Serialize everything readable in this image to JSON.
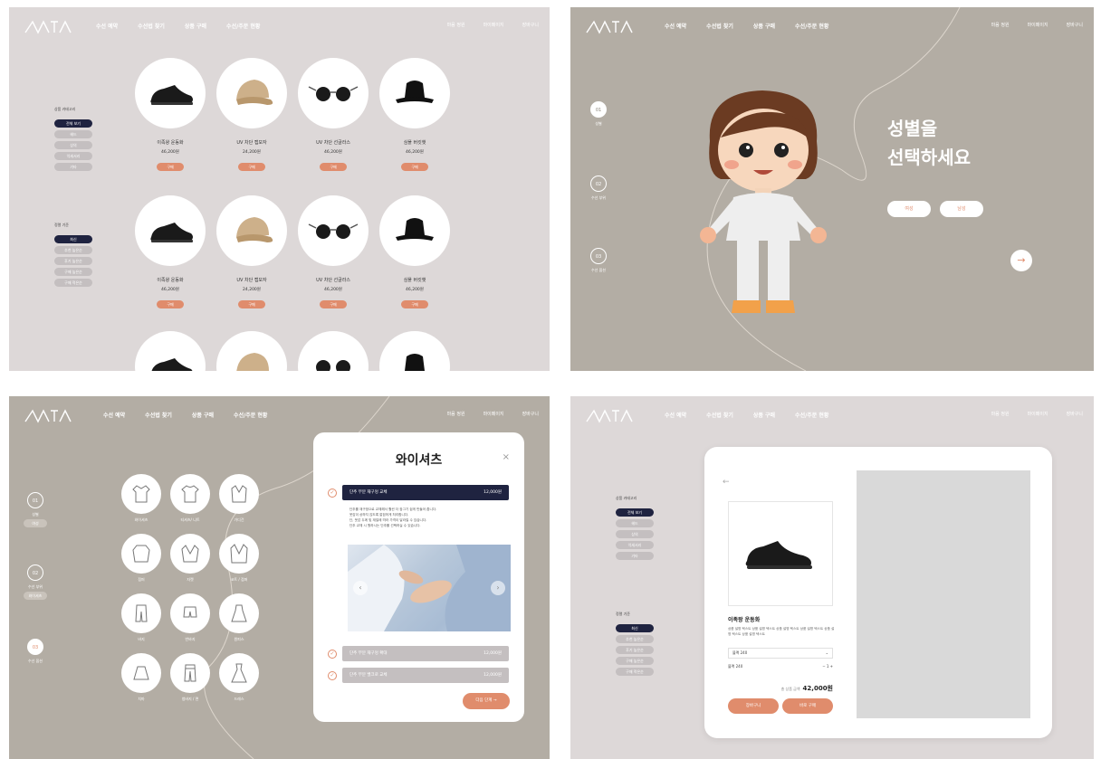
{
  "brand": "MVTIA",
  "nav": [
    "수선 예약",
    "수선법 찾기",
    "상품 구매",
    "수선/주문 현황"
  ],
  "utility": [
    "마음 정원",
    "마이페이지",
    "장바구니"
  ],
  "shop": {
    "category_title": "상품 카테고리",
    "categories": [
      "전체 보기",
      "헤드",
      "상의",
      "악세서리",
      "기타"
    ],
    "sort_title": "정렬 기준",
    "sorts": [
      "최신",
      "추천 높은순",
      "후기 높은순",
      "구매 높은순",
      "구매 적은순"
    ],
    "buy_label": "구매",
    "products": [
      {
        "name": "이족왕 운동화",
        "price": "46,200원",
        "icon": "sneaker"
      },
      {
        "name": "UV 차단 캡모자",
        "price": "24,200원",
        "icon": "cap"
      },
      {
        "name": "UV 차단 선글라스",
        "price": "46,200원",
        "icon": "sunglasses"
      },
      {
        "name": "심플 버킷햇",
        "price": "46,200원",
        "icon": "bucket-hat"
      }
    ]
  },
  "gender": {
    "steps": [
      {
        "num": "01",
        "label": "성별"
      },
      {
        "num": "02",
        "label": "수선 부위"
      },
      {
        "num": "03",
        "label": "수선 옵션"
      }
    ],
    "title_line1": "성별을",
    "title_line2": "선택하세요",
    "female": "여성",
    "male": "남성",
    "next_arrow": "→"
  },
  "repair": {
    "steps": [
      {
        "num": "01",
        "label": "성별",
        "sub": "여성"
      },
      {
        "num": "02",
        "label": "수선 부위",
        "sub": "와이셔츠"
      },
      {
        "num": "03",
        "label": "수선 옵션"
      }
    ],
    "garments": [
      "와이셔츠",
      "티셔츠/ 니트",
      "가디건",
      "점퍼",
      "자켓",
      "코트 / 점퍼",
      "바지",
      "반바지",
      "원피스",
      "치마",
      "청바지 / 면",
      "드레스"
    ],
    "modal": {
      "title": "와이셔츠",
      "close": "×",
      "option1": "단추 부분 재구멍 교체",
      "price1": "12,000원",
      "desc": [
        "단추를 재구멍으로 교체해서 훨씬 더 잠그기 쉽게 만들어 줍니다.",
        "옷감이 상하지 않도록 깔끔하게 처리합니다.",
        "단, 옷감 두께 및 재질에 따라 가격이 달라질 수 있습니다.",
        "단추 교체 시 원하시는 단추를 선택하실 수 있습니다."
      ],
      "option2": "단추 부분 재구멍 확대",
      "price2": "12,000원",
      "option3": "단추 부분 밸크로 교체",
      "price3": "12,000원",
      "next": "다음 단계",
      "prev_arrow": "‹",
      "next_arrow": "›"
    }
  },
  "detail": {
    "back": "←",
    "name": "이족왕 운동화",
    "desc": "상품 설명 텍스트 상품 설명 텍스트 상품 설명 텍스트 상품 설명 텍스트 상품 설명 텍스트 상품 설명 텍스트",
    "option_value": "블랙 240",
    "option_chevron": "⌄",
    "qty_label": "블랙 240",
    "qty_value": "1",
    "total_label": "총 상품 금액",
    "total_value": "42,000원",
    "cart": "장바구니",
    "buy_now": "바로 구매"
  },
  "colors": {
    "accent": "#e08c6c",
    "navy": "#1f2340",
    "beige": "#b3ada4",
    "pink_gray": "#ddd8d8"
  }
}
